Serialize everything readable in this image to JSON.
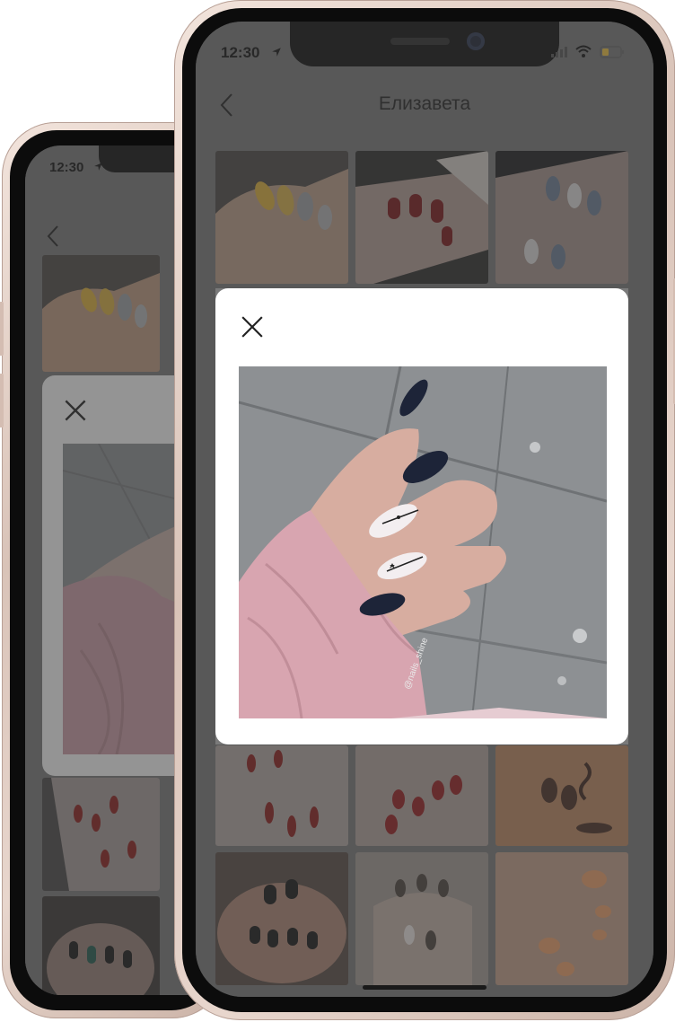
{
  "back_phone": {
    "status_time": "12:30",
    "modal_close_label": "close"
  },
  "front_phone": {
    "status_time": "12:30",
    "header": {
      "title": "Елизавета"
    },
    "modal": {
      "close_label": "close",
      "watermark": "@nails_shine"
    },
    "grid_rows": 4
  },
  "colors": {
    "phone_frame": "#e6d4ca",
    "overlay": "#7a7a7a",
    "modal_bg": "#ffffff",
    "nail_navy": "#1d2438",
    "nail_white": "#f3eef0",
    "sweater_pink": "#d9a9b3",
    "battery_yellow": "#f4c542"
  }
}
